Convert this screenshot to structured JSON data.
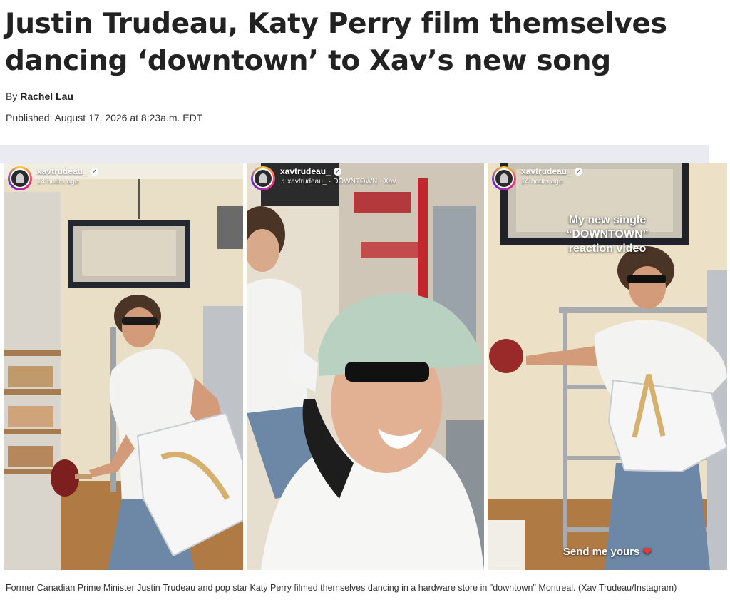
{
  "article": {
    "headline": "Justin Trudeau, Katy Perry film themselves dancing ‘downtown’ to Xav’s new song",
    "byline_prefix": "By",
    "author": "Rachel Lau",
    "published": "Published: August 17, 2026 at 8:23a.m. EDT"
  },
  "gallery": {
    "panels": [
      {
        "username": "xavtrudeau_",
        "subtitle": "14 hours ago"
      },
      {
        "username": "xavtrudeau_",
        "music_note": "♫",
        "subtitle": "xavtrudeau_ · DOWNTOWN · Xav"
      },
      {
        "username": "xavtrudeau_",
        "subtitle": "14 hours ago",
        "overlay_line1": "My new single",
        "overlay_line2": "“DOWNTOWN”",
        "overlay_line3": "reaction video",
        "bottom_text": "Send me yours",
        "heart": "❤"
      }
    ],
    "verified_mark": "✓"
  },
  "caption": "Former Canadian Prime Minister Justin Trudeau and pop star Katy Perry filmed themselves dancing in a hardware store in \"downtown\" Montreal. (Xav Trudeau/Instagram)",
  "colors": {
    "headline": "#222222",
    "strip": "#e9ebf1",
    "wall": "#ece1c7",
    "shirt": "#f3f3f1",
    "jeans": "#6d88a6",
    "cap": "#b8d1c0",
    "heart": "#e53935"
  },
  "icons": [
    "verified-icon",
    "music-note-icon",
    "heart-icon"
  ]
}
